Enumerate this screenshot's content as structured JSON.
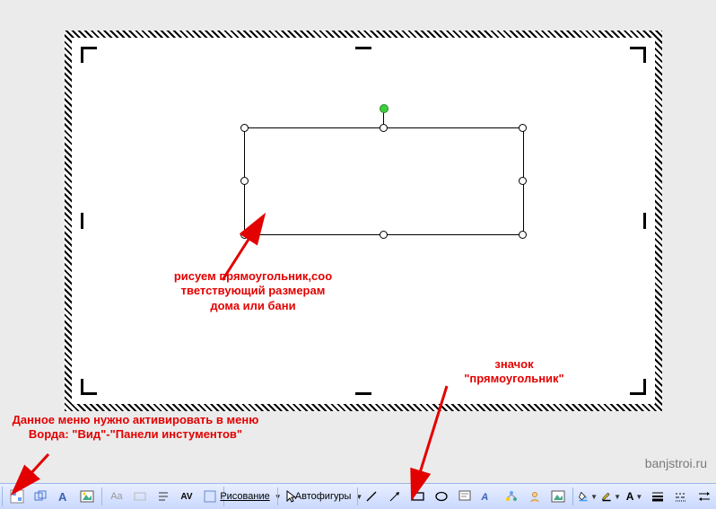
{
  "annotations": {
    "rect_label": "рисуем прямоугольник,соо тветствующий размерам дома или бани",
    "icon_label": "значок \"прямоугольник\"",
    "menu_note": "Данное меню нужно активировать в меню Ворда: \"Вид\"-\"Панели инстументов\""
  },
  "watermark": "banjstroi.ru",
  "toolbar": {
    "draw_label": "Рисование",
    "autoshapes_label": "Автофигуры",
    "aa_btn1": "Aa",
    "aa_btn2": "AV",
    "letter_a": "A"
  },
  "colors": {
    "annotation": "#e30000",
    "rot_handle": "#3ecf3e"
  }
}
